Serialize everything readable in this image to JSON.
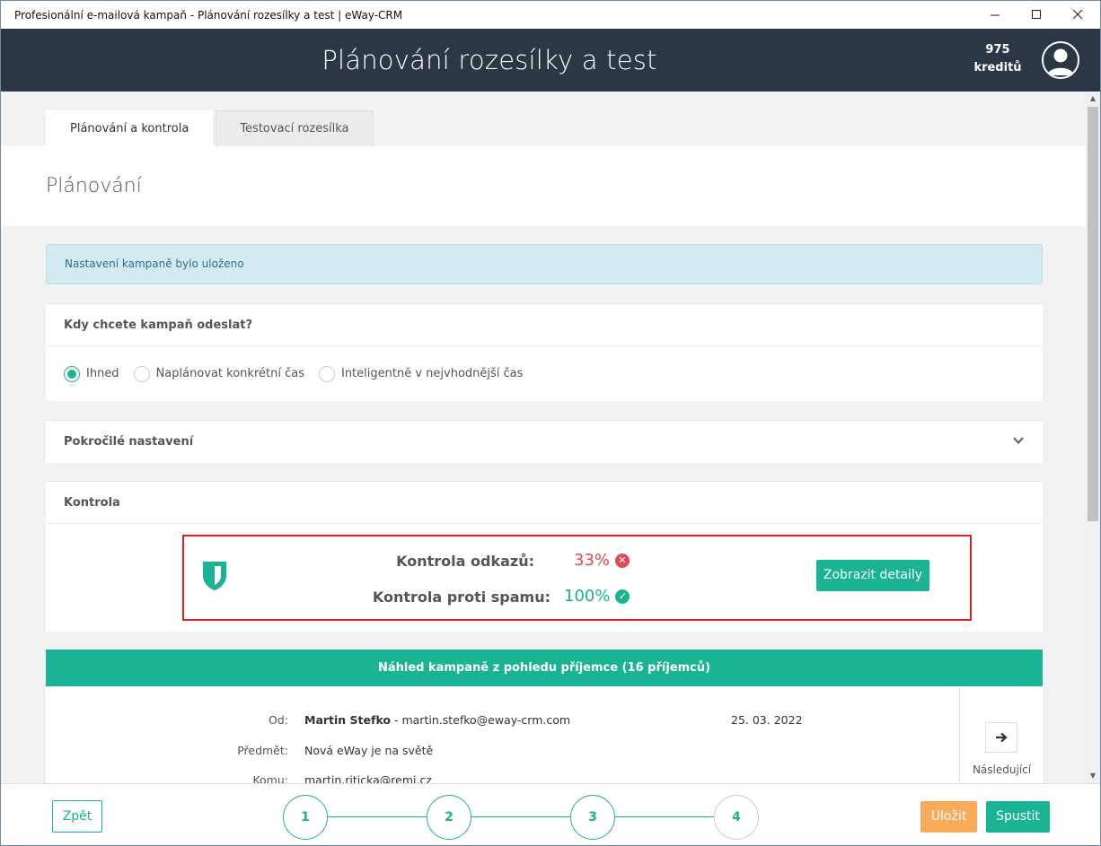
{
  "window": {
    "title": "Profesionální e-mailová kampaň - Plánování rozesílky a test | eWay-CRM",
    "min_icon": "minimize-icon",
    "max_icon": "maximize-icon",
    "close_icon": "close-icon"
  },
  "header": {
    "title": "Plánování rozesílky a test",
    "credits_count": "975",
    "credits_label": "kreditů",
    "avatar_icon": "user-avatar-icon"
  },
  "tabs": [
    {
      "label": "Plánování a kontrola",
      "active": true
    },
    {
      "label": "Testovací rozesílka",
      "active": false
    }
  ],
  "section": {
    "title": "Plánování"
  },
  "alert": {
    "text": "Nastavení kampaně bylo uloženo"
  },
  "when": {
    "title": "Kdy chcete kampaň odeslat?",
    "options": [
      {
        "label": "Ihned",
        "checked": true
      },
      {
        "label": "Naplánovat konkrétní čas",
        "checked": false
      },
      {
        "label": "Inteligentně v nejvhodnější čas",
        "checked": false
      }
    ]
  },
  "advanced": {
    "title": "Pokročilé nastavení",
    "chevron_icon": "chevron-down-icon"
  },
  "control": {
    "title": "Kontrola",
    "shield_icon": "shield-icon",
    "links_label": "Kontrola odkazů:",
    "links_value": "33%",
    "links_status_icon": "error-circle-icon",
    "spam_label": "Kontrola proti spamu:",
    "spam_value": "100%",
    "spam_status_icon": "check-circle-icon",
    "details_button": "Zobrazit detaily",
    "colors": {
      "bad": "#e0495c",
      "good": "#1ab394",
      "highlight_border": "#dd2323"
    }
  },
  "preview": {
    "title": "Náhled kampaně z pohledu příjemce (16 příjemců)",
    "from_label": "Od:",
    "from_name": "Martin Stefko",
    "from_email": " - martin.stefko@eway-crm.com",
    "date": "25. 03. 2022",
    "subject_label": "Předmět:",
    "subject": "Nová eWay je na světě",
    "to_label": "Komu:",
    "to": "martin.riticka@remi.cz",
    "next_label": "Následující",
    "next_icon": "arrow-right-icon"
  },
  "footer": {
    "back": "Zpět",
    "steps": [
      "1",
      "2",
      "3",
      "4"
    ],
    "save": "Uložit",
    "run": "Spustit"
  },
  "colors": {
    "accent": "#1ab394",
    "header_bg": "#2b3744",
    "save": "#f8ac59",
    "alert_bg": "#d2ebf0"
  }
}
